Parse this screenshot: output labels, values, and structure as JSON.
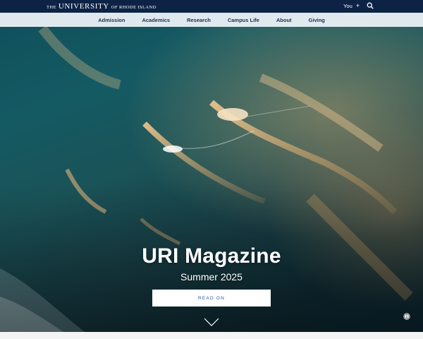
{
  "brand": {
    "the": "THE",
    "university": "UNIVERSITY",
    "of": "OF RHODE ISLAND"
  },
  "utility": {
    "you_label": "You",
    "plus_symbol": "+",
    "search_icon": "search-icon"
  },
  "nav": {
    "items": [
      {
        "label": "Admission"
      },
      {
        "label": "Academics"
      },
      {
        "label": "Research"
      },
      {
        "label": "Campus Life"
      },
      {
        "label": "About"
      },
      {
        "label": "Giving"
      }
    ]
  },
  "hero": {
    "title": "URI Magazine",
    "subtitle": "Summer 2025",
    "cta_label": "READ ON",
    "scroll_icon": "chevron-down-icon",
    "credit_icon": "info-icon"
  },
  "colors": {
    "topbar": "#0d2346",
    "nav_bg": "#ecf2f7",
    "nav_text": "#1b2f55",
    "cta_text": "#2a5aa8"
  }
}
